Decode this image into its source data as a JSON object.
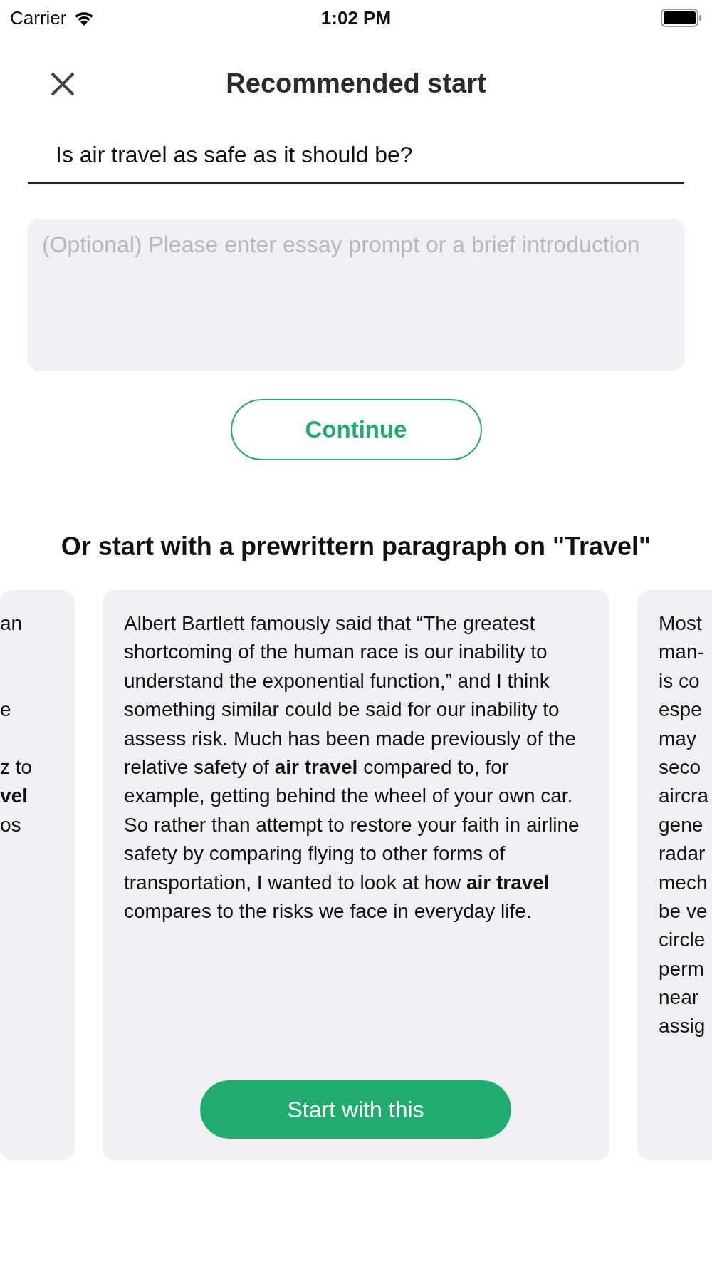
{
  "status_bar": {
    "carrier": "Carrier",
    "time": "1:02 PM"
  },
  "header": {
    "title": "Recommended start"
  },
  "topic_field": {
    "value": "Is air travel as safe as it should be?"
  },
  "prompt_field": {
    "placeholder": "(Optional) Please enter essay prompt or a brief introduction"
  },
  "continue_button": "Continue",
  "section_title": "Or start with a prewrittern paragraph on \"Travel\"",
  "cards": [
    {
      "kind": "partial-left",
      "lines": [
        {
          "kind": "text",
          "text": "an"
        },
        {
          "kind": "blank"
        },
        {
          "kind": "blank"
        },
        {
          "kind": "text",
          "text": "e"
        },
        {
          "kind": "blank"
        },
        {
          "kind": "text",
          "text": "z to"
        },
        {
          "kind": "bold",
          "text": "vel"
        },
        {
          "kind": "text",
          "text": "os"
        }
      ]
    },
    {
      "kind": "full",
      "text": "Albert Bartlett famously said that “The greatest shortcoming of the human race is our inability to understand the exponential function,” and I think something similar could be said for our inability to assess risk. Much has been made previously of the relative safety of **air travel** compared to, for example, getting behind the wheel of your own car. So rather than attempt to restore your faith in airline safety by comparing flying to other forms of transportation, I wanted to look at how **air travel** compares to the risks we face in everyday life.",
      "button": "Start with this"
    },
    {
      "kind": "partial-right",
      "lines": [
        {
          "kind": "text",
          "text": "Most"
        },
        {
          "kind": "text",
          "text": "man-"
        },
        {
          "kind": "text",
          "text": "is co"
        },
        {
          "kind": "text",
          "text": "espe"
        },
        {
          "kind": "text",
          "text": "may"
        },
        {
          "kind": "text",
          "text": "seco"
        },
        {
          "kind": "text",
          "text": "aircra"
        },
        {
          "kind": "text",
          "text": "gene"
        },
        {
          "kind": "text",
          "text": "radar"
        },
        {
          "kind": "text",
          "text": "mech"
        },
        {
          "kind": "text",
          "text": "be ve"
        },
        {
          "kind": "text",
          "text": "circle"
        },
        {
          "kind": "text",
          "text": "perm"
        },
        {
          "kind": "text",
          "text": "near"
        },
        {
          "kind": "text",
          "text": "assig"
        }
      ]
    }
  ]
}
